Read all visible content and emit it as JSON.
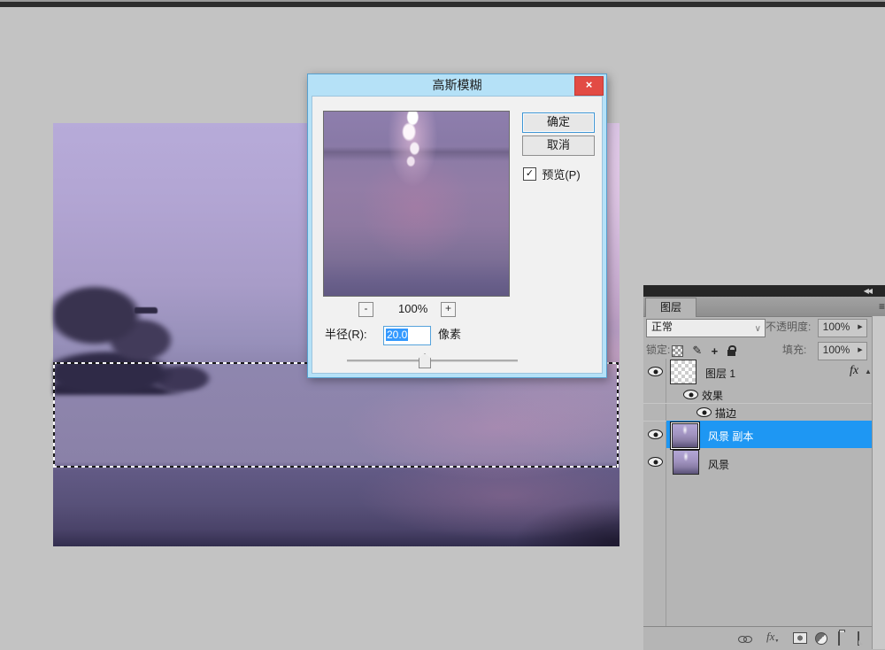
{
  "dialog": {
    "title": "高斯模糊",
    "ok_label": "确定",
    "cancel_label": "取消",
    "preview_label": "预览(P)",
    "zoom_out_label": "-",
    "zoom_level": "100%",
    "zoom_in_label": "+",
    "radius_label": "半径(R):",
    "radius_value": "20.0",
    "unit_label": "像素"
  },
  "panel": {
    "tab_label": "图层",
    "blend_mode": "正常",
    "opacity_label": "不透明度:",
    "opacity_value": "100%",
    "lock_label": "锁定:",
    "fill_label": "填充:",
    "fill_value": "100%",
    "layers": {
      "layer1": {
        "name": "图层 1",
        "fx": "fx"
      },
      "effects": {
        "name": "效果"
      },
      "stroke": {
        "name": "描边"
      },
      "copy": {
        "name": "风景 副本",
        "selected": true
      },
      "background": {
        "name": "风景"
      }
    }
  },
  "icons": {
    "close": "×",
    "collapse": "◀◀",
    "menu": "≡",
    "dropdown_arrow": "∨",
    "spinner_arrow": "▶",
    "caret_up": "▲",
    "check": "✓",
    "brush": "✎",
    "move": "+",
    "fx_small": "fx",
    "tiny_arrow": "▼"
  },
  "colors": {
    "selected_layer_blue": "#1e97f3",
    "dialog_chrome_blue": "#b5e1f7",
    "close_button_red": "#e24b44",
    "text_selection_blue": "#3399ff",
    "panel_gray": "#b5b5b5",
    "workspace_gray": "#c3c3c3"
  }
}
